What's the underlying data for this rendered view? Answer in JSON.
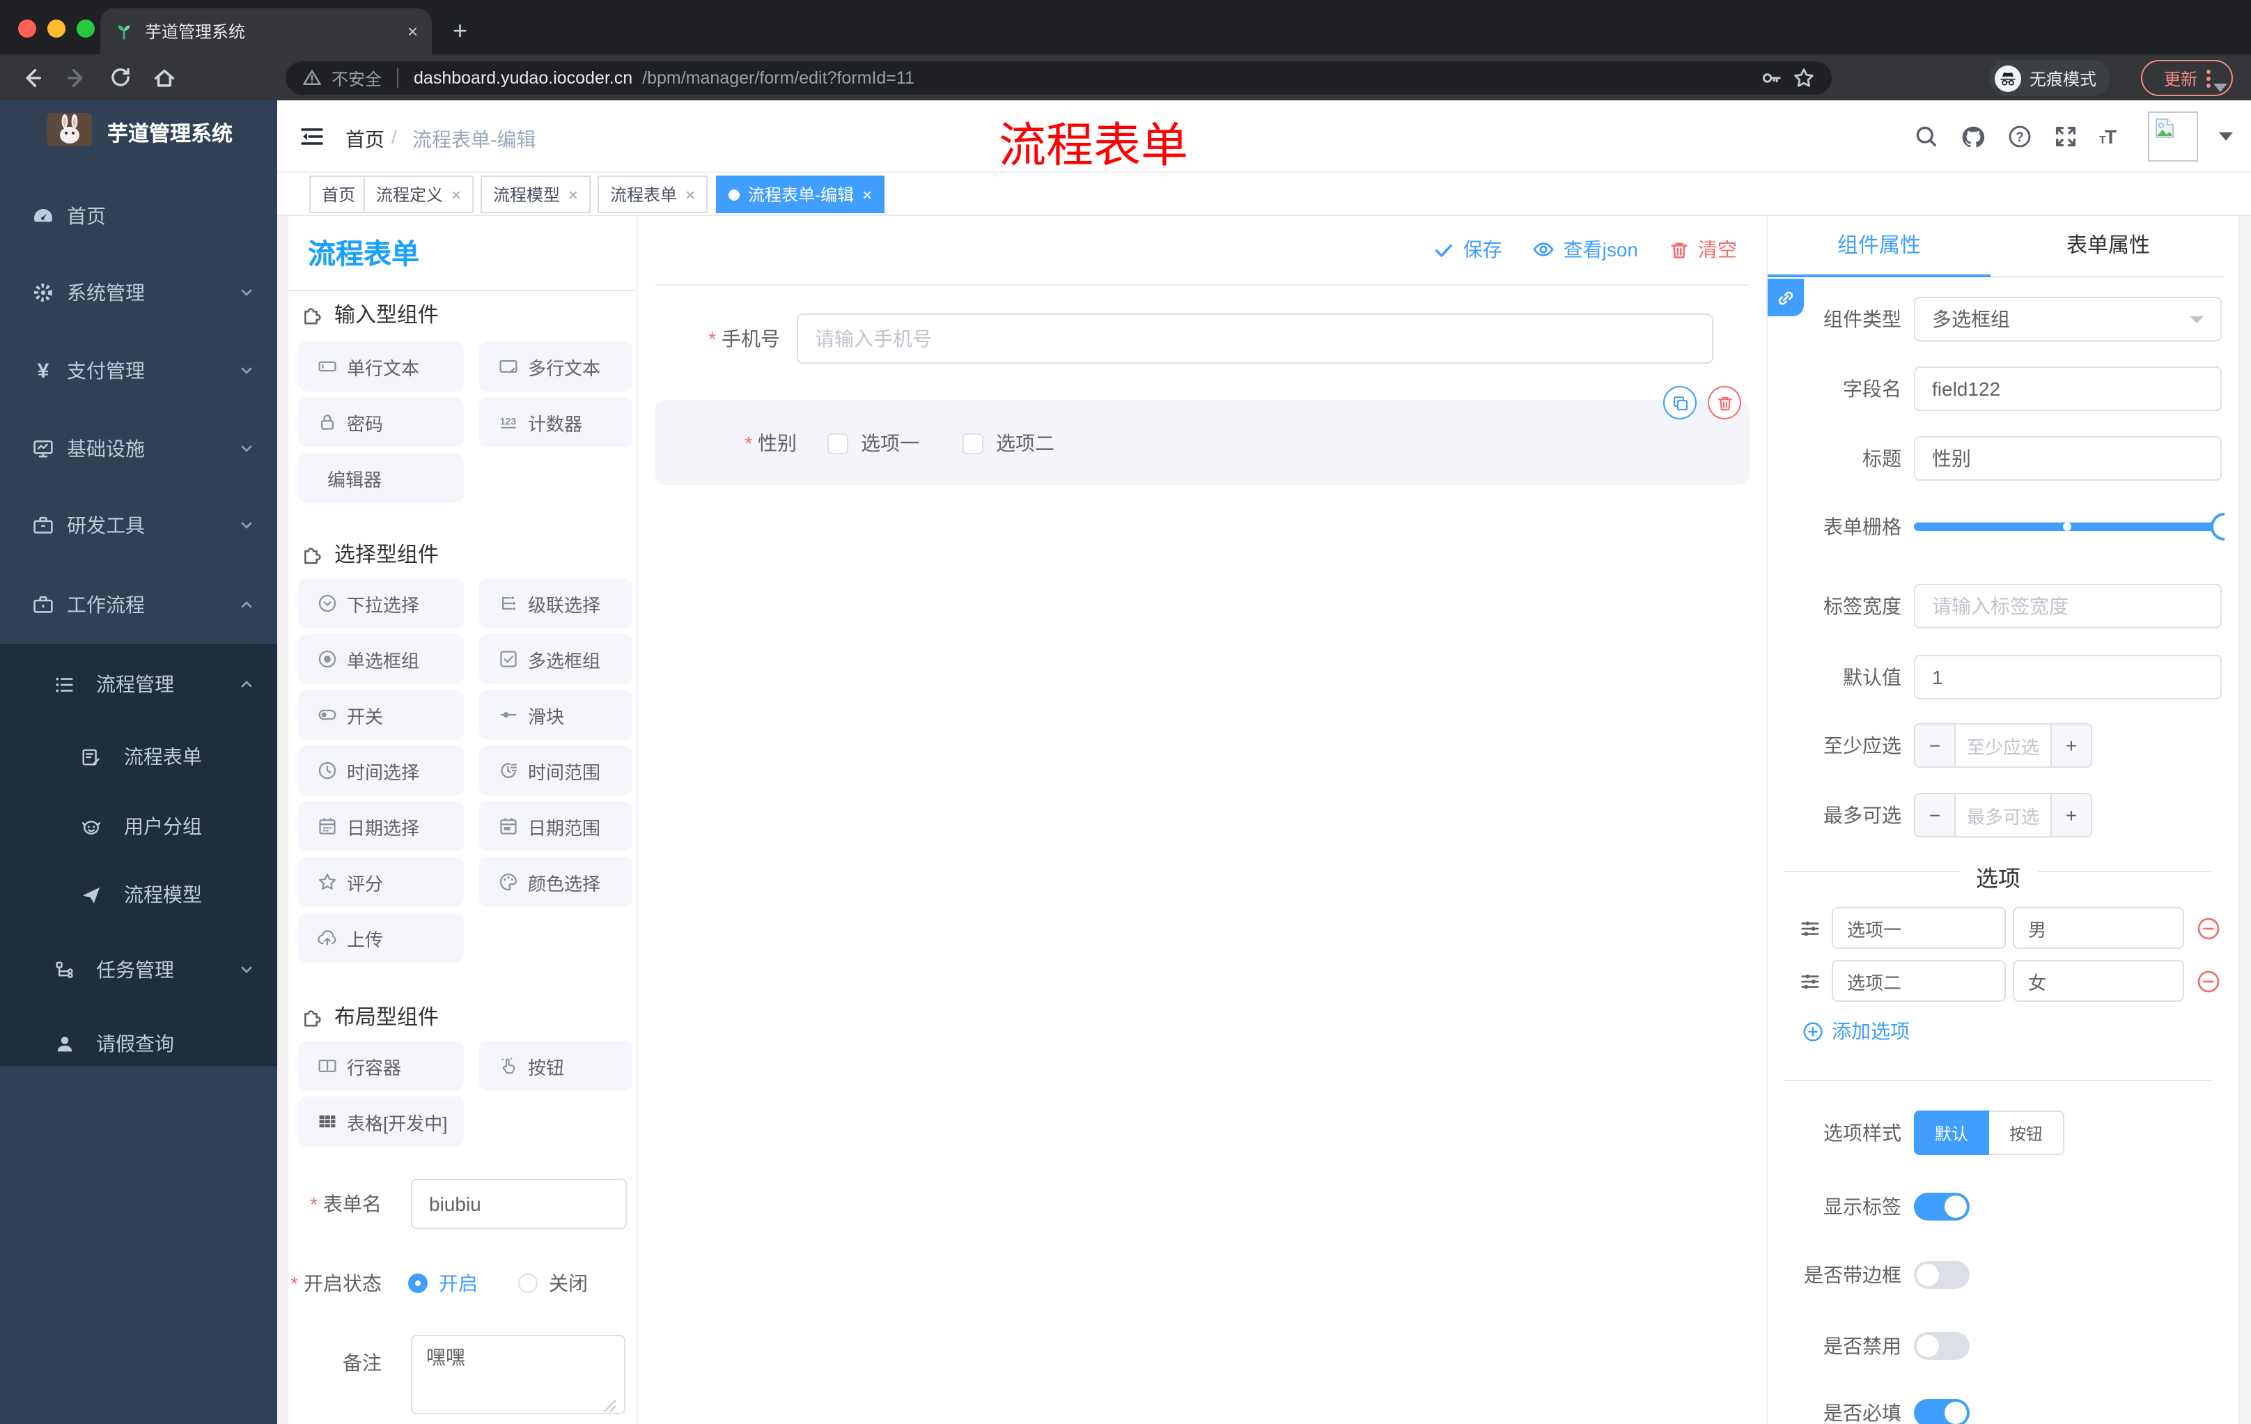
{
  "theme": {
    "accent": "#409eff",
    "danger": "#f56c6c",
    "watermark_red": "#ff0000",
    "palette_title_blue": "#1da1ff",
    "sidebar_bg": "#304156",
    "sidebar_submenu_bg": "#1f2d3d",
    "sidebar_text": "#bfcbd9"
  },
  "browser": {
    "tab_title": "芋道管理系统",
    "security_label": "不安全",
    "url_host": "dashboard.yudao.iocoder.cn",
    "url_path": "/bpm/manager/form/edit?formId=11",
    "incognito_label": "无痕模式",
    "update_label": "更新"
  },
  "sidebar": {
    "logo_title": "芋道管理系统",
    "items": [
      {
        "label": "首页"
      },
      {
        "label": "系统管理"
      },
      {
        "label": "支付管理"
      },
      {
        "label": "基础设施"
      },
      {
        "label": "研发工具"
      },
      {
        "label": "工作流程"
      }
    ],
    "workflow": {
      "process_manage": "流程管理",
      "children": [
        {
          "label": "流程表单"
        },
        {
          "label": "用户分组"
        },
        {
          "label": "流程模型"
        }
      ],
      "task_manage": "任务管理",
      "leave_query": "请假查询"
    }
  },
  "header": {
    "breadcrumb": [
      "首页",
      "流程表单-编辑"
    ],
    "watermark": "流程表单"
  },
  "page_tabs": [
    {
      "label": "首页",
      "closable": false,
      "active": false
    },
    {
      "label": "流程定义",
      "closable": true,
      "active": false
    },
    {
      "label": "流程模型",
      "closable": true,
      "active": false
    },
    {
      "label": "流程表单",
      "closable": true,
      "active": false
    },
    {
      "label": "流程表单-编辑",
      "closable": true,
      "active": true
    }
  ],
  "palette": {
    "title": "流程表单",
    "sections": [
      {
        "title": "输入型组件",
        "items": [
          "单行文本",
          "多行文本",
          "密码",
          "计数器",
          "编辑器"
        ]
      },
      {
        "title": "选择型组件",
        "items": [
          "下拉选择",
          "级联选择",
          "单选框组",
          "多选框组",
          "开关",
          "滑块",
          "时间选择",
          "时间范围",
          "日期选择",
          "日期范围",
          "评分",
          "颜色选择",
          "上传"
        ]
      },
      {
        "title": "布局型组件",
        "items": [
          "行容器",
          "按钮",
          "表格[开发中]"
        ]
      }
    ],
    "form": {
      "name_label": "表单名",
      "name_value": "biubiu",
      "status_label": "开启状态",
      "status_on": "开启",
      "status_off": "关闭",
      "status_selected": "开启",
      "remark_label": "备注",
      "remark_value": "嘿嘿"
    }
  },
  "canvas": {
    "toolbar": {
      "save": "保存",
      "view_json": "查看json",
      "clear": "清空"
    },
    "phone": {
      "label": "手机号",
      "placeholder": "请输入手机号",
      "required": true
    },
    "gender": {
      "label": "性别",
      "required": true,
      "option1": "选项一",
      "option2": "选项二",
      "selected": true
    }
  },
  "inspector": {
    "tabs": {
      "component": "组件属性",
      "form": "表单属性",
      "active": "组件属性"
    },
    "type_label": "组件类型",
    "type_value": "多选框组",
    "field_label": "字段名",
    "field_value": "field122",
    "title_label": "标题",
    "title_value": "性别",
    "grid_label": "表单栅格",
    "label_width_label": "标签宽度",
    "label_width_placeholder": "请输入标签宽度",
    "default_label": "默认值",
    "default_value": "1",
    "min_label": "至少应选",
    "min_placeholder": "至少应选",
    "max_label": "最多可选",
    "max_placeholder": "最多可选",
    "options_title": "选项",
    "options": [
      {
        "label": "选项一",
        "value": "男"
      },
      {
        "label": "选项二",
        "value": "女"
      }
    ],
    "add_option_label": "添加选项",
    "style_label": "选项样式",
    "style_options": [
      "默认",
      "按钮"
    ],
    "style_selected": "默认",
    "switches": [
      {
        "label": "显示标签",
        "on": true
      },
      {
        "label": "是否带边框",
        "on": false
      },
      {
        "label": "是否禁用",
        "on": false
      },
      {
        "label": "是否必填",
        "on": true
      }
    ]
  },
  "icons": {
    "save": "check",
    "view_json": "eye",
    "clear": "trash",
    "selected_component_actions": [
      "copy",
      "trash"
    ],
    "inspector_handle": "chain-link",
    "option_row_handle": "sliders",
    "remove_option": "minus-circle",
    "add_option": "plus-circle",
    "header_right": [
      "search",
      "github",
      "question",
      "fullscreen",
      "font-size",
      "avatar",
      "caret-down"
    ]
  }
}
